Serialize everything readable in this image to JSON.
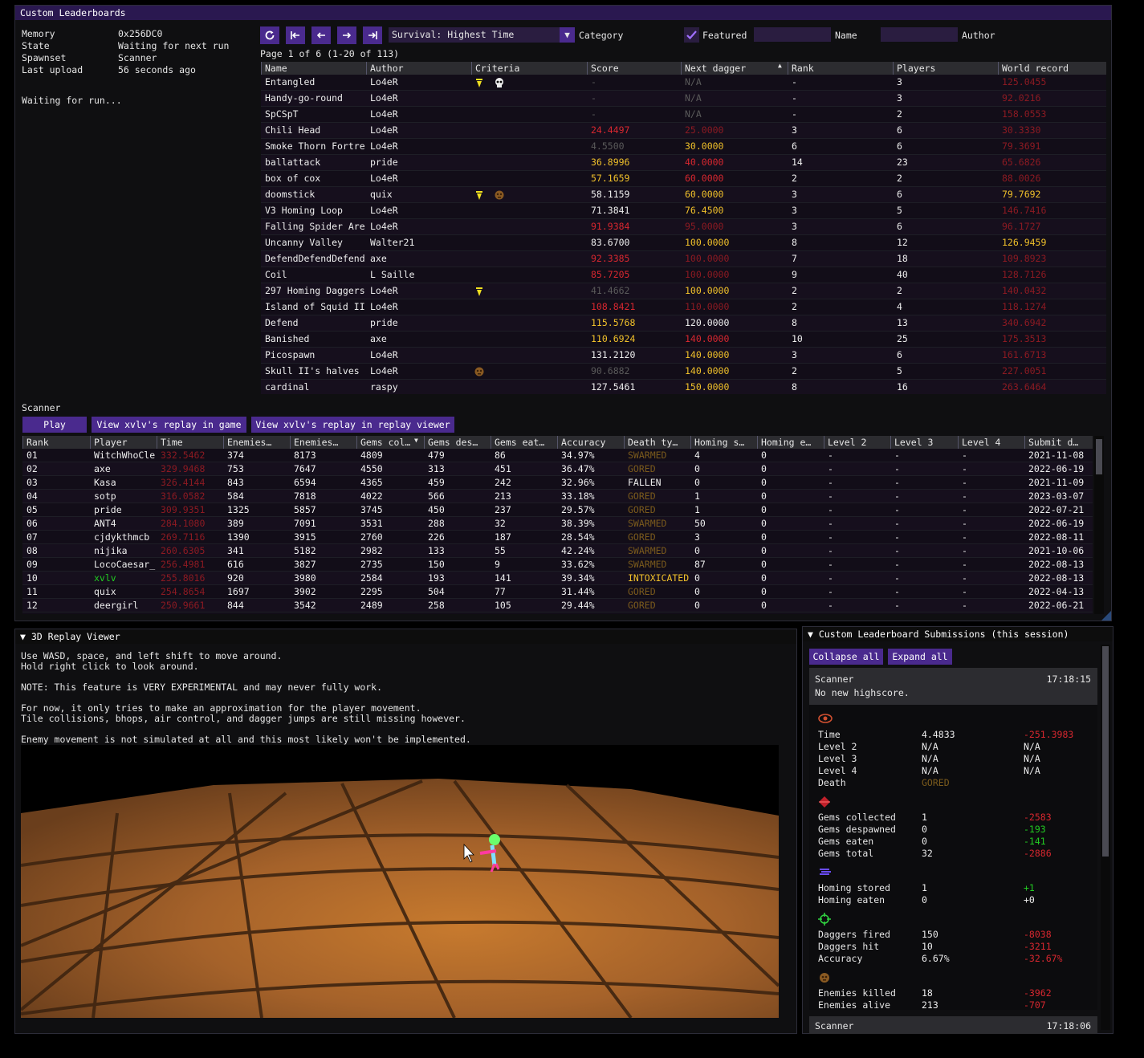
{
  "main_window": {
    "title": "Custom Leaderboards",
    "status": [
      {
        "label": "Memory",
        "value": "0x256DC0"
      },
      {
        "label": "State",
        "value": "Waiting for next run"
      },
      {
        "label": "Spawnset",
        "value": "Scanner"
      },
      {
        "label": "Last upload",
        "value": "56 seconds ago"
      }
    ],
    "waiting_text": "Waiting for run...",
    "toolbar": {
      "category_value": "Survival: Highest Time",
      "category_label": "Category",
      "featured_label": "Featured",
      "featured_checked": true,
      "name_label": "Name",
      "author_label": "Author",
      "page_info": "Page 1 of 6 (1-20 of 113)"
    },
    "leaderboard": {
      "columns": [
        "Name",
        "Author",
        "Criteria",
        "Score",
        "Next dagger",
        "Rank",
        "Players",
        "World record"
      ],
      "sort_icon": "▲",
      "rows": [
        {
          "name": "Entangled",
          "author": "Lo4eR",
          "crit": [
            "dagger",
            "skull"
          ],
          "score": "-",
          "sc": "gray",
          "next": "N/A",
          "nc": "gray",
          "rank": "-",
          "players": "3",
          "wr": "125.0455",
          "wc": "dimred"
        },
        {
          "name": "Handy-go-round",
          "author": "Lo4eR",
          "crit": [],
          "score": "-",
          "sc": "gray",
          "next": "N/A",
          "nc": "gray",
          "rank": "-",
          "players": "3",
          "wr": "92.0216",
          "wc": "dimred"
        },
        {
          "name": "SpCSpT",
          "author": "Lo4eR",
          "crit": [],
          "score": "-",
          "sc": "gray",
          "next": "N/A",
          "nc": "gray",
          "rank": "-",
          "players": "2",
          "wr": "158.0553",
          "wc": "dimred"
        },
        {
          "name": "Chili Head",
          "author": "Lo4eR",
          "crit": [],
          "score": "24.4497",
          "sc": "red",
          "next": "25.0000",
          "nc": "dimred",
          "rank": "3",
          "players": "6",
          "wr": "30.3330",
          "wc": "dimred"
        },
        {
          "name": "Smoke Thorn Fortre",
          "author": "Lo4eR",
          "crit": [],
          "score": "4.5500",
          "sc": "gray",
          "next": "30.0000",
          "nc": "yellow",
          "rank": "6",
          "players": "6",
          "wr": "79.3691",
          "wc": "dimred"
        },
        {
          "name": "ballattack",
          "author": "pride",
          "crit": [],
          "score": "36.8996",
          "sc": "yellow",
          "next": "40.0000",
          "nc": "red",
          "rank": "14",
          "players": "23",
          "wr": "65.6826",
          "wc": "dimred"
        },
        {
          "name": "box of cox",
          "author": "Lo4eR",
          "crit": [],
          "score": "57.1659",
          "sc": "yellow",
          "next": "60.0000",
          "nc": "red",
          "rank": "2",
          "players": "2",
          "wr": "88.0026",
          "wc": "dimred"
        },
        {
          "name": "doomstick",
          "author": "quix",
          "crit": [
            "dagger",
            "enemy"
          ],
          "score": "58.1159",
          "sc": "white",
          "next": "60.0000",
          "nc": "yellow",
          "rank": "3",
          "players": "6",
          "wr": "79.7692",
          "wc": "yellow"
        },
        {
          "name": "V3 Homing Loop",
          "author": "Lo4eR",
          "crit": [],
          "score": "71.3841",
          "sc": "white",
          "next": "76.4500",
          "nc": "yellow",
          "rank": "3",
          "players": "5",
          "wr": "146.7416",
          "wc": "dimred"
        },
        {
          "name": "Falling Spider Are",
          "author": "Lo4eR",
          "crit": [],
          "score": "91.9384",
          "sc": "red",
          "next": "95.0000",
          "nc": "dimred",
          "rank": "3",
          "players": "6",
          "wr": "96.1727",
          "wc": "dimred"
        },
        {
          "name": "Uncanny Valley",
          "author": "Walter21",
          "crit": [],
          "score": "83.6700",
          "sc": "white",
          "next": "100.0000",
          "nc": "yellow",
          "rank": "8",
          "players": "12",
          "wr": "126.9459",
          "wc": "yellow"
        },
        {
          "name": "DefendDefendDefend",
          "author": "axe",
          "crit": [],
          "score": "92.3385",
          "sc": "red",
          "next": "100.0000",
          "nc": "dimred",
          "rank": "7",
          "players": "18",
          "wr": "109.8923",
          "wc": "dimred"
        },
        {
          "name": "Coil",
          "author": "L Saille",
          "crit": [],
          "score": "85.7205",
          "sc": "red",
          "next": "100.0000",
          "nc": "dimred",
          "rank": "9",
          "players": "40",
          "wr": "128.7126",
          "wc": "dimred"
        },
        {
          "name": "297 Homing Daggers",
          "author": "Lo4eR",
          "crit": [
            "dagger"
          ],
          "score": "41.4662",
          "sc": "gray",
          "next": "100.0000",
          "nc": "yellow",
          "rank": "2",
          "players": "2",
          "wr": "140.0432",
          "wc": "dimred"
        },
        {
          "name": "Island of Squid II",
          "author": "Lo4eR",
          "crit": [],
          "score": "108.8421",
          "sc": "red",
          "next": "110.0000",
          "nc": "dimred",
          "rank": "2",
          "players": "4",
          "wr": "118.1274",
          "wc": "dimred"
        },
        {
          "name": "Defend",
          "author": "pride",
          "crit": [],
          "score": "115.5768",
          "sc": "yellow",
          "next": "120.0000",
          "nc": "white",
          "rank": "8",
          "players": "13",
          "wr": "340.6942",
          "wc": "dimred"
        },
        {
          "name": "Banished",
          "author": "axe",
          "crit": [],
          "score": "110.6924",
          "sc": "yellow",
          "next": "140.0000",
          "nc": "red",
          "rank": "10",
          "players": "25",
          "wr": "175.3513",
          "wc": "dimred"
        },
        {
          "name": "Picospawn",
          "author": "Lo4eR",
          "crit": [],
          "score": "131.2120",
          "sc": "white",
          "next": "140.0000",
          "nc": "yellow",
          "rank": "3",
          "players": "6",
          "wr": "161.6713",
          "wc": "dimred"
        },
        {
          "name": "Skull II's halves",
          "author": "Lo4eR",
          "crit": [
            "enemy"
          ],
          "score": "90.6882",
          "sc": "gray",
          "next": "140.0000",
          "nc": "yellow",
          "rank": "2",
          "players": "5",
          "wr": "227.0051",
          "wc": "dimred"
        },
        {
          "name": "cardinal",
          "author": "raspy",
          "crit": [],
          "score": "127.5461",
          "sc": "white",
          "next": "150.0000",
          "nc": "yellow",
          "rank": "8",
          "players": "16",
          "wr": "263.6464",
          "wc": "dimred"
        }
      ]
    },
    "scanner": {
      "title": "Scanner",
      "play_label": "Play",
      "replay_game_label": "View xvlv's replay in game",
      "replay_viewer_label": "View xvlv's replay in replay viewer",
      "columns": [
        "Rank",
        "Player",
        "Time",
        "Enemies…",
        "Enemies…",
        "Gems col…",
        "Gems des…",
        "Gems eat…",
        "Accuracy",
        "Death ty…",
        "Homing s…",
        "Homing e…",
        "Level 2",
        "Level 3",
        "Level 4",
        "Submit d…"
      ],
      "rows": [
        {
          "rank": "01",
          "player": "WitchWhoCle",
          "pc": "white",
          "time": "332.5462",
          "ek": "374",
          "ea": "8173",
          "gc": "4809",
          "gd": "479",
          "ge": "86",
          "acc": "34.97%",
          "death": "SWARMED",
          "dc": "brown",
          "hs": "4",
          "he": "0",
          "l2": "-",
          "l3": "-",
          "l4": "-",
          "date": "2021-11-08"
        },
        {
          "rank": "02",
          "player": "axe",
          "pc": "white",
          "time": "329.9468",
          "ek": "753",
          "ea": "7647",
          "gc": "4550",
          "gd": "313",
          "ge": "451",
          "acc": "36.47%",
          "death": "GORED",
          "dc": "brown",
          "hs": "0",
          "he": "0",
          "l2": "-",
          "l3": "-",
          "l4": "-",
          "date": "2022-06-19"
        },
        {
          "rank": "03",
          "player": "Kasa",
          "pc": "white",
          "time": "326.4144",
          "ek": "843",
          "ea": "6594",
          "gc": "4365",
          "gd": "459",
          "ge": "242",
          "acc": "32.96%",
          "death": "FALLEN",
          "dc": "white",
          "hs": "0",
          "he": "0",
          "l2": "-",
          "l3": "-",
          "l4": "-",
          "date": "2021-11-09"
        },
        {
          "rank": "04",
          "player": "sotp",
          "pc": "white",
          "time": "316.0582",
          "ek": "584",
          "ea": "7818",
          "gc": "4022",
          "gd": "566",
          "ge": "213",
          "acc": "33.18%",
          "death": "GORED",
          "dc": "brown",
          "hs": "1",
          "he": "0",
          "l2": "-",
          "l3": "-",
          "l4": "-",
          "date": "2023-03-07"
        },
        {
          "rank": "05",
          "player": "pride",
          "pc": "white",
          "time": "309.9351",
          "ek": "1325",
          "ea": "5857",
          "gc": "3745",
          "gd": "450",
          "ge": "237",
          "acc": "29.57%",
          "death": "GORED",
          "dc": "brown",
          "hs": "1",
          "he": "0",
          "l2": "-",
          "l3": "-",
          "l4": "-",
          "date": "2022-07-21"
        },
        {
          "rank": "06",
          "player": "ANT4",
          "pc": "white",
          "time": "284.1080",
          "ek": "389",
          "ea": "7091",
          "gc": "3531",
          "gd": "288",
          "ge": "32",
          "acc": "38.39%",
          "death": "SWARMED",
          "dc": "brown",
          "hs": "50",
          "he": "0",
          "l2": "-",
          "l3": "-",
          "l4": "-",
          "date": "2022-06-19"
        },
        {
          "rank": "07",
          "player": "cjdykthmcb",
          "pc": "white",
          "time": "269.7116",
          "ek": "1390",
          "ea": "3915",
          "gc": "2760",
          "gd": "226",
          "ge": "187",
          "acc": "28.54%",
          "death": "GORED",
          "dc": "brown",
          "hs": "3",
          "he": "0",
          "l2": "-",
          "l3": "-",
          "l4": "-",
          "date": "2022-08-11"
        },
        {
          "rank": "08",
          "player": "nijika",
          "pc": "white",
          "time": "260.6305",
          "ek": "341",
          "ea": "5182",
          "gc": "2982",
          "gd": "133",
          "ge": "55",
          "acc": "42.24%",
          "death": "SWARMED",
          "dc": "brown",
          "hs": "0",
          "he": "0",
          "l2": "-",
          "l3": "-",
          "l4": "-",
          "date": "2021-10-06"
        },
        {
          "rank": "09",
          "player": "LocoCaesar_",
          "pc": "white",
          "time": "256.4981",
          "ek": "616",
          "ea": "3827",
          "gc": "2735",
          "gd": "150",
          "ge": "9",
          "acc": "33.62%",
          "death": "SWARMED",
          "dc": "brown",
          "hs": "87",
          "he": "0",
          "l2": "-",
          "l3": "-",
          "l4": "-",
          "date": "2022-08-13"
        },
        {
          "rank": "10",
          "player": "xvlv",
          "pc": "green",
          "time": "255.8016",
          "ek": "920",
          "ea": "3980",
          "gc": "2584",
          "gd": "193",
          "ge": "141",
          "acc": "39.34%",
          "death": "INTOXICATED",
          "dc": "yellow",
          "hs": "0",
          "he": "0",
          "l2": "-",
          "l3": "-",
          "l4": "-",
          "date": "2022-08-13"
        },
        {
          "rank": "11",
          "player": "quix",
          "pc": "white",
          "time": "254.8654",
          "ek": "1697",
          "ea": "3902",
          "gc": "2295",
          "gd": "504",
          "ge": "77",
          "acc": "31.44%",
          "death": "GORED",
          "dc": "brown",
          "hs": "0",
          "he": "0",
          "l2": "-",
          "l3": "-",
          "l4": "-",
          "date": "2022-04-13"
        },
        {
          "rank": "12",
          "player": "deergirl",
          "pc": "white",
          "time": "250.9661",
          "ek": "844",
          "ea": "3542",
          "gc": "2489",
          "gd": "258",
          "ge": "105",
          "acc": "29.44%",
          "death": "GORED",
          "dc": "brown",
          "hs": "0",
          "he": "0",
          "l2": "-",
          "l3": "-",
          "l4": "-",
          "date": "2022-06-21"
        }
      ]
    }
  },
  "replay_viewer": {
    "title": "3D Replay Viewer",
    "lines": [
      "Use WASD, space, and left shift to move around.",
      "Hold right click to look around.",
      "",
      "NOTE: This feature is VERY EXPERIMENTAL and may never fully work.",
      "",
      "For now, it only tries to make an approximation for the player movement.",
      "Tile collisions, bhops, air control, and dagger jumps are still missing however.",
      "",
      "Enemy movement is not simulated at all and this most likely won't be implemented."
    ]
  },
  "submissions": {
    "title": "Custom Leaderboard Submissions (this session)",
    "collapse_label": "Collapse all",
    "expand_label": "Expand all",
    "entry1": {
      "spawnset": "Scanner",
      "time": "17:18:15",
      "message": "No new highscore."
    },
    "entry2": {
      "spawnset": "Scanner",
      "time": "17:18:06"
    },
    "stats": {
      "time_group": [
        {
          "label": "Time",
          "value": "4.4833",
          "diff": "-251.3983",
          "dc": "red"
        },
        {
          "label": "Level 2",
          "value": "N/A",
          "diff": "N/A",
          "dc": "white"
        },
        {
          "label": "Level 3",
          "value": "N/A",
          "diff": "N/A",
          "dc": "white"
        },
        {
          "label": "Level 4",
          "value": "N/A",
          "diff": "N/A",
          "dc": "white"
        },
        {
          "label": "Death",
          "value": "GORED",
          "diff": "",
          "dc": "white",
          "vc": "brown"
        }
      ],
      "gems_group": [
        {
          "label": "Gems collected",
          "value": "1",
          "diff": "-2583",
          "dc": "red"
        },
        {
          "label": "Gems despawned",
          "value": "0",
          "diff": "-193",
          "dc": "green"
        },
        {
          "label": "Gems eaten",
          "value": "0",
          "diff": "-141",
          "dc": "green"
        },
        {
          "label": "Gems total",
          "value": "32",
          "diff": "-2886",
          "dc": "red"
        }
      ],
      "homing_group": [
        {
          "label": "Homing stored",
          "value": "1",
          "diff": "+1",
          "dc": "green"
        },
        {
          "label": "Homing eaten",
          "value": "0",
          "diff": "+0",
          "dc": "white"
        }
      ],
      "dagger_group": [
        {
          "label": "Daggers fired",
          "value": "150",
          "diff": "-8038",
          "dc": "red"
        },
        {
          "label": "Daggers hit",
          "value": "10",
          "diff": "-3211",
          "dc": "red"
        },
        {
          "label": "Accuracy",
          "value": "6.67%",
          "diff": "-32.67%",
          "dc": "red"
        }
      ],
      "enemy_group": [
        {
          "label": "Enemies killed",
          "value": "18",
          "diff": "-3962",
          "dc": "red"
        },
        {
          "label": "Enemies alive",
          "value": "213",
          "diff": "-707",
          "dc": "red"
        }
      ]
    }
  },
  "icons": {
    "refresh": "refresh-icon",
    "first": "first-page-icon",
    "prev": "prev-page-icon",
    "next": "next-page-icon",
    "last": "last-page-icon",
    "dropdown": "chevron-down-icon",
    "check": "check-icon",
    "eye": "eye-icon",
    "gem": "gem-icon",
    "homing": "homing-icon",
    "crosshair": "crosshair-icon",
    "skull": "enemy-icon"
  },
  "colors": {
    "accent": "#4a2a8e",
    "titlebar": "#2a1850",
    "red": "#d8272f",
    "yellow": "#f0c02a",
    "green": "#22cc22",
    "brown": "#7a5a1c"
  }
}
